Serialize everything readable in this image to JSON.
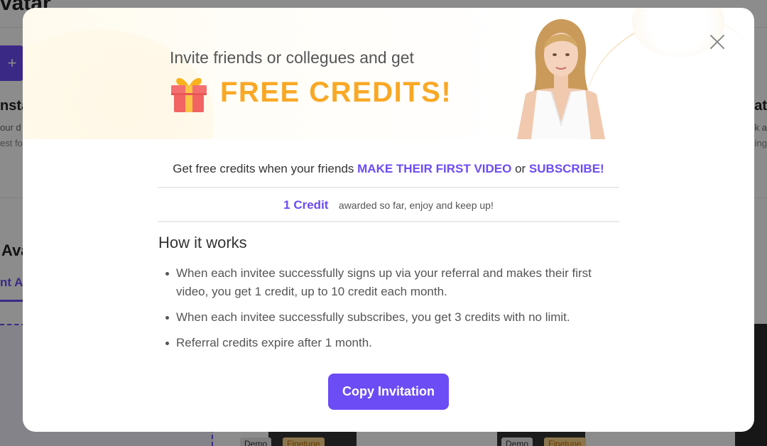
{
  "background": {
    "header_title": "vatar",
    "left_card": {
      "title": "nsta",
      "line1": "our d",
      "line2": "est fo"
    },
    "right_card": {
      "title": "vat",
      "line1": "4k a",
      "line2": "ing"
    },
    "section_title": "Ava",
    "active_tab": "nt A",
    "video_badges": [
      {
        "demo": "Demo",
        "finetune": "Finetune"
      },
      {
        "demo": "Demo",
        "finetune": "Finetune"
      }
    ]
  },
  "modal": {
    "banner": {
      "subtitle": "Invite friends or collegues and get",
      "headline": "FREE CREDITS!",
      "gift_icon": "gift-icon",
      "headline_color": "#f9a825"
    },
    "close_icon": "close-icon",
    "intro": {
      "prefix": "Get free credits when your friends ",
      "highlight1": "MAKE THEIR FIRST VIDEO",
      "middle": " or ",
      "highlight2": "SUBSCRIBE!"
    },
    "credits": {
      "count": "1 Credit",
      "note": "awarded so far, enjoy and keep up!"
    },
    "how_it_works": {
      "title": "How it works",
      "items": [
        "When each invitee successfully signs up via your referral and makes their first video, you get 1 credit, up to 10 credit each month.",
        "When each invitee successfully subscribes, you get 3 credits with no limit.",
        "Referral credits expire after 1 month."
      ]
    },
    "copy_button": "Copy Invitation",
    "accent_color": "#6c4cf5"
  }
}
